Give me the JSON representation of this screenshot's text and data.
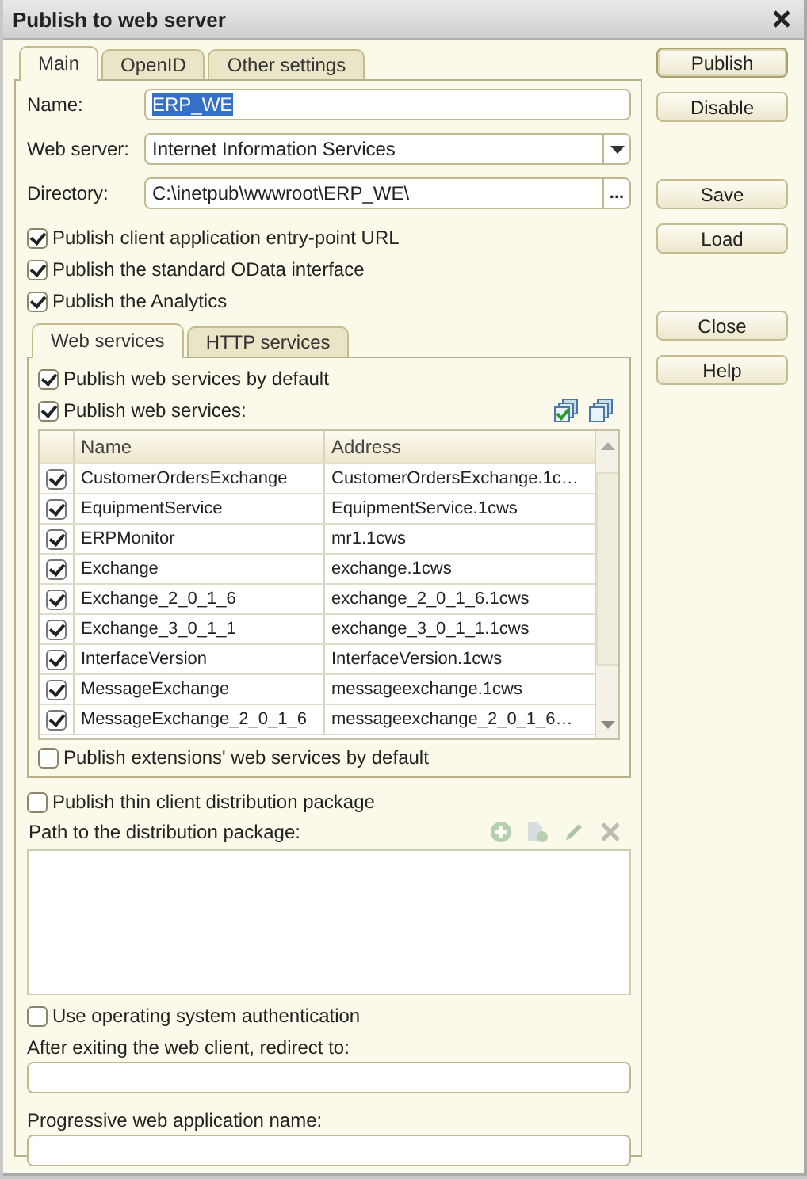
{
  "window": {
    "title": "Publish to web server"
  },
  "tabs": [
    {
      "label": "Main",
      "selected": true
    },
    {
      "label": "OpenID",
      "selected": false
    },
    {
      "label": "Other settings",
      "selected": false
    }
  ],
  "fields": [
    {
      "kind": "text",
      "label": "Name:",
      "value": "ERP_WE",
      "highlighted": true
    },
    {
      "kind": "dropdown",
      "label": "Web server:",
      "value": "Internet Information Services"
    },
    {
      "kind": "path",
      "label": "Directory:",
      "value": "C:\\inetpub\\wwwroot\\ERP_WE\\",
      "button": "..."
    }
  ],
  "options": [
    {
      "label": "Publish client application entry-point URL",
      "checked": true
    },
    {
      "label": "Publish the standard OData interface",
      "checked": true
    },
    {
      "label": "Publish the Analytics",
      "checked": true
    }
  ],
  "service_tabs": [
    {
      "label": "Web services",
      "selected": true
    },
    {
      "label": "HTTP services",
      "selected": false
    }
  ],
  "web_services": {
    "options": [
      {
        "label": "Publish web services by default",
        "checked": true
      },
      {
        "label": "Publish web services:",
        "checked": true
      }
    ],
    "table": {
      "columns": [
        "Name",
        "Address"
      ],
      "rows": [
        {
          "checked": true,
          "name": "CustomerOrdersExchange",
          "address": "CustomerOrdersExchange.1c…"
        },
        {
          "checked": true,
          "name": "EquipmentService",
          "address": "EquipmentService.1cws"
        },
        {
          "checked": true,
          "name": "ERPMonitor",
          "address": "mr1.1cws"
        },
        {
          "checked": true,
          "name": "Exchange",
          "address": "exchange.1cws"
        },
        {
          "checked": true,
          "name": "Exchange_2_0_1_6",
          "address": "exchange_2_0_1_6.1cws"
        },
        {
          "checked": true,
          "name": "Exchange_3_0_1_1",
          "address": "exchange_3_0_1_1.1cws"
        },
        {
          "checked": true,
          "name": "InterfaceVersion",
          "address": "InterfaceVersion.1cws"
        },
        {
          "checked": true,
          "name": "MessageExchange",
          "address": "messageexchange.1cws"
        },
        {
          "checked": true,
          "name": "MessageExchange_2_0_1_6",
          "address": "messageexchange_2_0_1_6…"
        }
      ]
    },
    "extensions_option": {
      "label": "Publish extensions' web services by default",
      "checked": false
    }
  },
  "thin_client": {
    "label": "Publish thin client distribution package",
    "checked": false
  },
  "package_path": {
    "label": "Path to the distribution package:",
    "toolbar_disabled": true
  },
  "os_auth": {
    "label": "Use operating system authentication",
    "checked": false
  },
  "redirect": {
    "label": "After exiting the web client, redirect to:"
  },
  "pwa_name": {
    "label": "Progressive web application name:"
  },
  "button_groups": [
    [
      {
        "label": "Publish",
        "default": true
      },
      {
        "label": "Disable",
        "default": false
      }
    ],
    [
      {
        "label": "Save",
        "default": false
      },
      {
        "label": "Load",
        "default": false
      }
    ],
    [
      {
        "label": "Close",
        "default": false
      },
      {
        "label": "Help",
        "default": false
      }
    ]
  ]
}
